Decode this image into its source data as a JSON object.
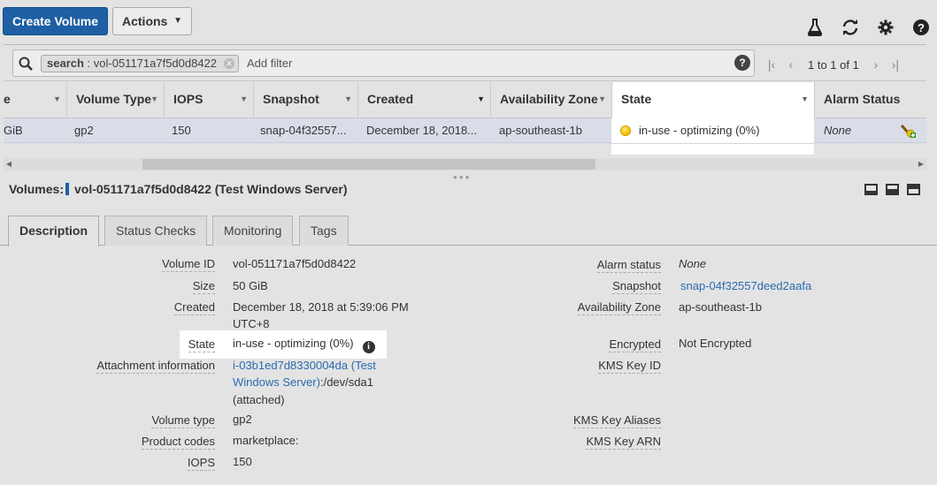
{
  "toolbar": {
    "create_label": "Create Volume",
    "actions_label": "Actions"
  },
  "filter": {
    "token_key": "search",
    "token_value": "vol-051171a7f5d0d8422",
    "add_filter": "Add filter",
    "pager_text": "1 to 1 of 1"
  },
  "table": {
    "columns": [
      "Volume Type",
      "IOPS",
      "Snapshot",
      "Created",
      "Availability Zone",
      "State",
      "Alarm Status"
    ],
    "row": {
      "size": "GiB",
      "volume_type": "gp2",
      "iops": "150",
      "snapshot": "snap-04f32557...",
      "created": "December 18, 2018...",
      "az": "ap-southeast-1b",
      "state": "in-use - optimizing (0%)",
      "alarm_status": "None"
    }
  },
  "details": {
    "prefix": "Volumes:",
    "title": "vol-051171a7f5d0d8422 (Test Windows Server)",
    "tabs": [
      "Description",
      "Status Checks",
      "Monitoring",
      "Tags"
    ],
    "left": {
      "volume_id_label": "Volume ID",
      "volume_id": "vol-051171a7f5d0d8422",
      "size_label": "Size",
      "size": "50 GiB",
      "created_label": "Created",
      "created_line1": "December 18, 2018 at 5:39:06 PM",
      "created_line2": "UTC+8",
      "state_label": "State",
      "state": "in-use - optimizing (0%)",
      "attachment_label": "Attachment information",
      "attachment_link1": "i-03b1ed7d8330004da (Test",
      "attachment_link2": "Windows Server)",
      "attachment_rest2": ":/dev/sda1",
      "attachment_line3": "(attached)",
      "volume_type_label": "Volume type",
      "volume_type": "gp2",
      "product_codes_label": "Product codes",
      "product_codes": "marketplace:",
      "iops_label": "IOPS",
      "iops": "150"
    },
    "right": {
      "alarm_label": "Alarm status",
      "alarm": "None",
      "snapshot_label": "Snapshot",
      "snapshot": "snap-04f32557deed2aafa",
      "az_label": "Availability Zone",
      "az": "ap-southeast-1b",
      "encrypted_label": "Encrypted",
      "encrypted": "Not Encrypted",
      "kms_id_label": "KMS Key ID",
      "kms_aliases_label": "KMS Key Aliases",
      "kms_arn_label": "KMS Key ARN"
    }
  },
  "colors": {
    "primary": "#1f5fa3",
    "link": "#2b6bb0",
    "row_selected": "#d9dde8"
  }
}
